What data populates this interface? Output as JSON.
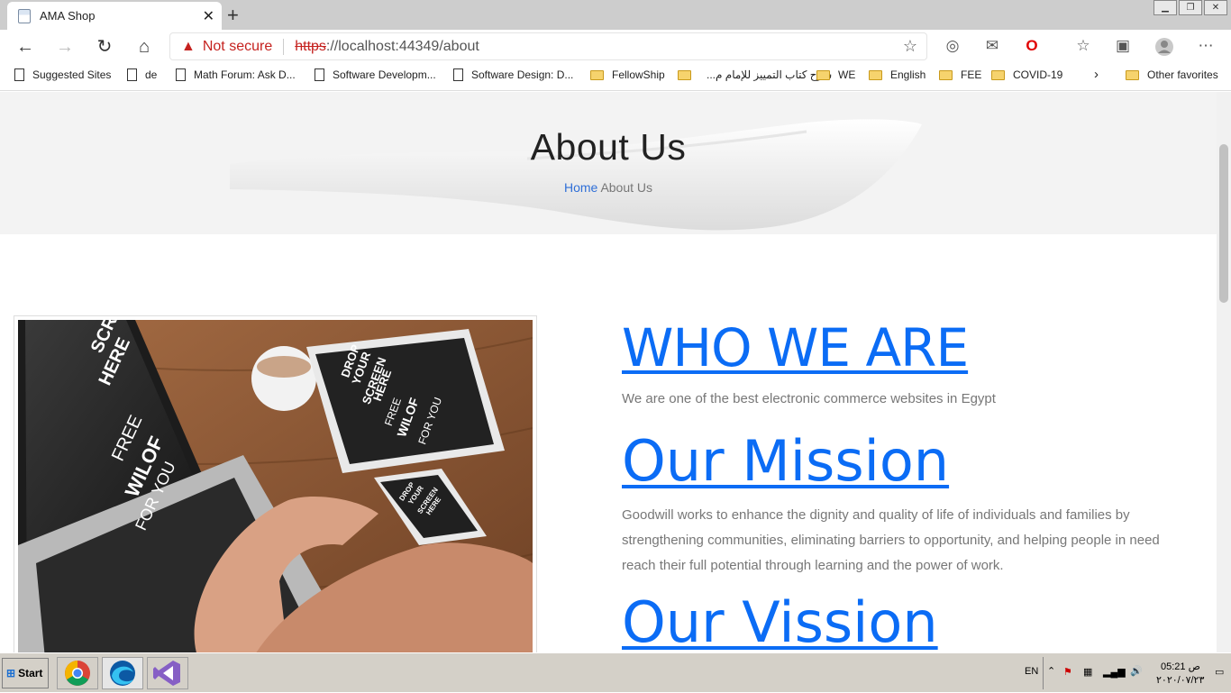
{
  "browser": {
    "tab_title": "AMA Shop",
    "security_label": "Not secure",
    "url_scheme": "https",
    "url_rest": "://localhost:44349/about"
  },
  "bookmarks": [
    {
      "label": "Suggested Sites",
      "type": "page"
    },
    {
      "label": "de",
      "type": "page"
    },
    {
      "label": "Math Forum: Ask D...",
      "type": "page"
    },
    {
      "label": "Software Developm...",
      "type": "page"
    },
    {
      "label": "Software Design: D...",
      "type": "page"
    },
    {
      "label": "FellowShip",
      "type": "folder"
    },
    {
      "label": "شرح كتاب التمييز للإمام م...",
      "type": "folder"
    },
    {
      "label": "WE",
      "type": "folder"
    },
    {
      "label": "English",
      "type": "folder"
    },
    {
      "label": "FEE",
      "type": "folder"
    },
    {
      "label": "COVID-19",
      "type": "folder"
    },
    {
      "label": "Other favorites",
      "type": "folder"
    }
  ],
  "hero": {
    "title": "About Us",
    "breadcrumb_home": "Home",
    "breadcrumb_current": "About Us"
  },
  "about": {
    "who_heading": "WHO WE ARE",
    "who_text": "We are one of the best electronic commerce websites in Egypt",
    "mission_heading": "Our Mission",
    "mission_text": "Goodwill works to enhance the dignity and quality of life of individuals and families by strengthening communities, eliminating barriers to opportunity, and helping people in need reach their full potential through learning and the power of work.",
    "vision_heading": "Our Vission"
  },
  "photo": {
    "laptop_text": [
      "SCR",
      "HERE",
      "FREE",
      "WILOF",
      "FOR YOU"
    ],
    "tablet_text": [
      "DROP",
      "YOUR",
      "SCREEN",
      "HERE",
      "FREE",
      "WILOF",
      "FOR YOU"
    ],
    "phone_text": [
      "DROP",
      "YOUR",
      "SCREEN",
      "HERE"
    ]
  },
  "taskbar": {
    "start_label": "Start",
    "lang": "EN",
    "time": "05:21 ص",
    "date": "٢٠٢٠/٠٧/٢٣"
  },
  "colors": {
    "link_blue": "#0b6cf5",
    "not_secure_red": "#c5221f"
  }
}
